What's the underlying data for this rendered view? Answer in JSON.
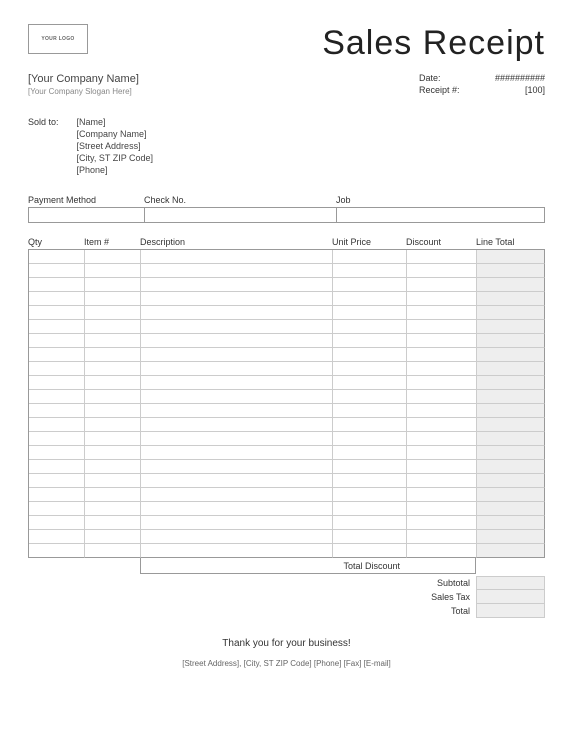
{
  "logo_text": "YOUR LOGO",
  "title": "Sales Receipt",
  "company": {
    "name": "[Your Company Name]",
    "slogan": "[Your Company Slogan Here]"
  },
  "meta": {
    "date_label": "Date:",
    "date_value": "##########",
    "receipt_label": "Receipt #:",
    "receipt_value": "[100]"
  },
  "sold_to": {
    "label": "Sold to:",
    "name": "[Name]",
    "company": "[Company Name]",
    "street": "[Street Address]",
    "csz": "[City, ST ZIP Code]",
    "phone": "[Phone]"
  },
  "payment": {
    "method_label": "Payment Method",
    "check_label": "Check No.",
    "job_label": "Job"
  },
  "columns": {
    "qty": "Qty",
    "item": "Item #",
    "desc": "Description",
    "unit": "Unit Price",
    "disc": "Discount",
    "total": "Line Total"
  },
  "totals": {
    "total_discount": "Total Discount",
    "subtotal": "Subtotal",
    "sales_tax": "Sales Tax",
    "total": "Total"
  },
  "thank_you": "Thank you for your business!",
  "footer": "[Street Address], [City, ST ZIP Code]   [Phone]   [Fax]   [E-mail]",
  "line_count": 22
}
